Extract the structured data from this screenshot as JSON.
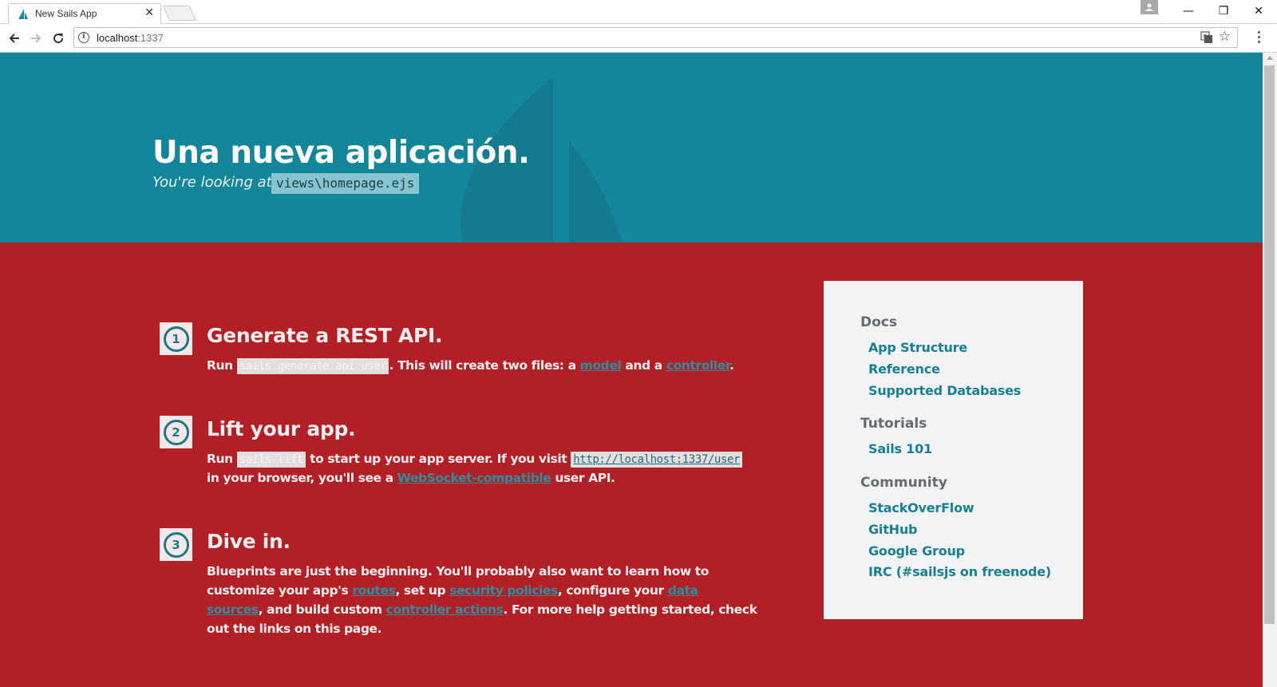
{
  "browser": {
    "tab_title": "New Sails App",
    "tab_close": "✕",
    "url_host": "localhost",
    "url_port": ":1337",
    "window_controls": {
      "minimize": "—",
      "restore": "❐",
      "close": "✕"
    },
    "star": "☆"
  },
  "hero": {
    "title": "Una nueva aplicación.",
    "subtitle": "You're looking at:",
    "file_code": "views\\homepage.ejs"
  },
  "steps": [
    {
      "number": "1",
      "title": "Generate a REST API.",
      "text": {
        "run": "Run ",
        "code": "sails generate api user",
        "mid": ". This will create two files: a ",
        "link1": "model",
        "and": " and a ",
        "link2": "controller",
        "end": "."
      }
    },
    {
      "number": "2",
      "title": "Lift your app.",
      "text": {
        "run": "Run ",
        "code": "sails lift",
        "mid": " to start up your app server. If you visit ",
        "url": "http://localhost:1337/user",
        "mid2": " in your browser, you'll see a ",
        "link": "WebSocket-compatible",
        "end": " user API."
      }
    },
    {
      "number": "3",
      "title": "Dive in.",
      "text": {
        "p1": "Blueprints are just the beginning. You'll probably also want to learn how to customize your app's ",
        "routes": "routes",
        "p2": ", set up ",
        "security": "security policies",
        "p3": ", configure your ",
        "datasources": "data sources",
        "p4": ", and build custom ",
        "actions": "controller actions",
        "p5": ". For more help getting started, check out the links on this page."
      }
    }
  ],
  "sidebar": {
    "docs_heading": "Docs",
    "docs_links": [
      "App Structure",
      "Reference",
      "Supported Databases"
    ],
    "tutorials_heading": "Tutorials",
    "tutorials_links": [
      "Sails 101"
    ],
    "community_heading": "Community",
    "community_links": [
      "StackOverFlow",
      "GitHub",
      "Google Group",
      "IRC (#sailsjs on freenode)"
    ]
  },
  "colors": {
    "hero_bg": "#14869a",
    "main_bg": "#b21f24",
    "link": "#1a7f92",
    "sidebar_bg": "#f1f3f5"
  }
}
